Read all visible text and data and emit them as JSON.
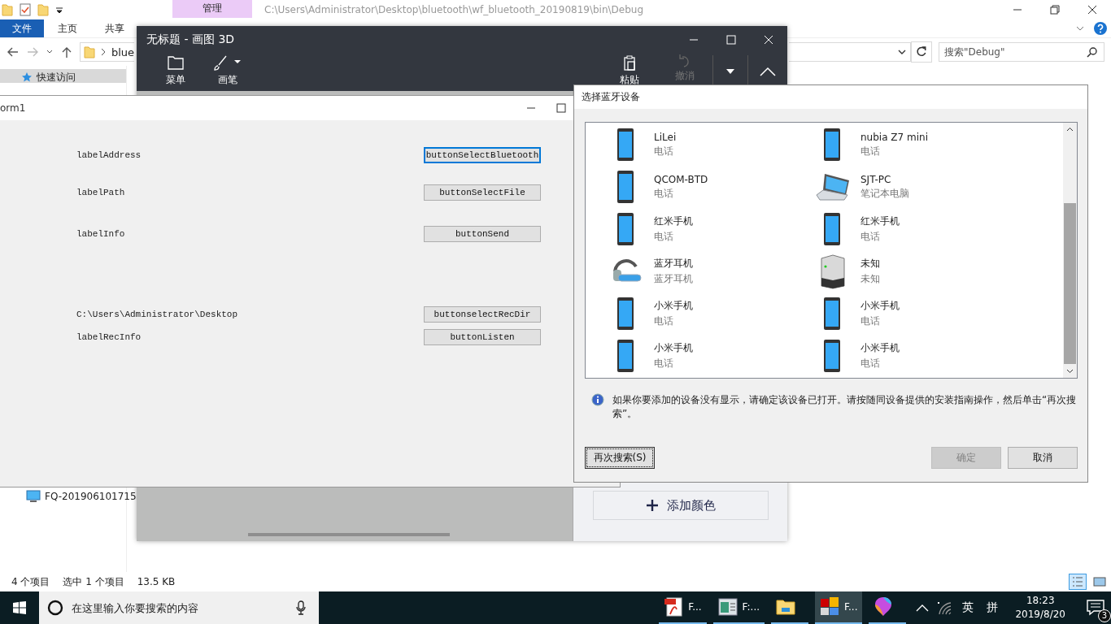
{
  "explorer": {
    "context_tab": "管理",
    "path": "C:\\Users\\Administrator\\Desktop\\bluetooth\\wf_bluetooth_20190819\\bin\\Debug",
    "ribbon_tabs": [
      {
        "label": "文件",
        "kind": "file"
      },
      {
        "label": "主页",
        "kind": "tab"
      },
      {
        "label": "共享",
        "kind": "tab"
      }
    ],
    "address_crumb": "blue",
    "search": {
      "placeholder": "搜索\"Debug\""
    },
    "nav_items": [
      {
        "label": "快速访问",
        "kind": "star",
        "selected": true
      },
      {
        "label": "FQ-201906101715",
        "kind": "computer",
        "selected": false
      }
    ],
    "status_bar": [
      "4 个项目",
      "选中 1 个项目",
      "13.5 KB"
    ]
  },
  "paint3d": {
    "title": "无标题 - 画图 3D",
    "left_tools": [
      {
        "label": "菜单",
        "kind": "folder"
      },
      {
        "label": "画笔",
        "kind": "brush"
      }
    ],
    "right_tools": [
      {
        "label": "粘贴",
        "kind": "paste",
        "disabled": false
      },
      {
        "label": "撤消",
        "kind": "undo",
        "disabled": true
      }
    ],
    "add_color_button": "添加颜色"
  },
  "form1": {
    "title": "orm1",
    "rows": [
      {
        "label": "labelAddress",
        "button": "buttonSelectBluetooth",
        "focused": true
      },
      {
        "label": "labelPath",
        "button": "buttonSelectFile",
        "focused": false
      },
      {
        "label": "labelInfo",
        "button": "buttonSend",
        "focused": false
      },
      {
        "label": "C:\\Users\\Administrator\\Desktop",
        "button": "buttonselectRecDir",
        "focused": false
      },
      {
        "label": "labelRecInfo",
        "button": "buttonListen",
        "focused": false
      }
    ]
  },
  "dialog": {
    "title": "选择蓝牙设备",
    "devices": [
      {
        "name": "LiLei",
        "type": "电话",
        "kind": "phone"
      },
      {
        "name": "nubia Z7 mini",
        "type": "电话",
        "kind": "phone"
      },
      {
        "name": "QCOM-BTD",
        "type": "电话",
        "kind": "phone"
      },
      {
        "name": "SJT-PC",
        "type": "笔记本电脑",
        "kind": "laptop"
      },
      {
        "name": "红米手机",
        "type": "电话",
        "kind": "phone"
      },
      {
        "name": "红米手机",
        "type": "电话",
        "kind": "phone"
      },
      {
        "name": "蓝牙耳机",
        "type": "蓝牙耳机",
        "kind": "headset"
      },
      {
        "name": "未知",
        "type": "未知",
        "kind": "unknown"
      },
      {
        "name": "小米手机",
        "type": "电话",
        "kind": "phone"
      },
      {
        "name": "小米手机",
        "type": "电话",
        "kind": "phone"
      },
      {
        "name": "小米手机",
        "type": "电话",
        "kind": "phone"
      },
      {
        "name": "小米手机",
        "type": "电话",
        "kind": "phone"
      }
    ],
    "info": "如果你要添加的设备没有显示，请确定该设备已打开。请按随同设备提供的安装指南操作，然后单击“再次搜索”。",
    "buttons": [
      {
        "label": "再次搜索(S)",
        "disabled": false,
        "focused": true
      },
      {
        "label": "确定",
        "disabled": true,
        "focused": false
      },
      {
        "label": "取消",
        "disabled": false,
        "focused": false
      }
    ]
  },
  "taskbar": {
    "search": {
      "placeholder": "在这里输入你要搜索的内容"
    },
    "apps": [
      {
        "label": "F...",
        "kind": "pdf",
        "active": false
      },
      {
        "label": "F:...",
        "kind": "app",
        "active": false
      },
      {
        "kind": "folder",
        "active": false
      },
      {
        "label": "F...",
        "kind": "tiles",
        "active": true
      },
      {
        "kind": "paint",
        "active": false
      }
    ],
    "ime": [
      "英",
      "拼"
    ],
    "time": "18:23",
    "date": "2019/8/20",
    "notifications": "3"
  }
}
